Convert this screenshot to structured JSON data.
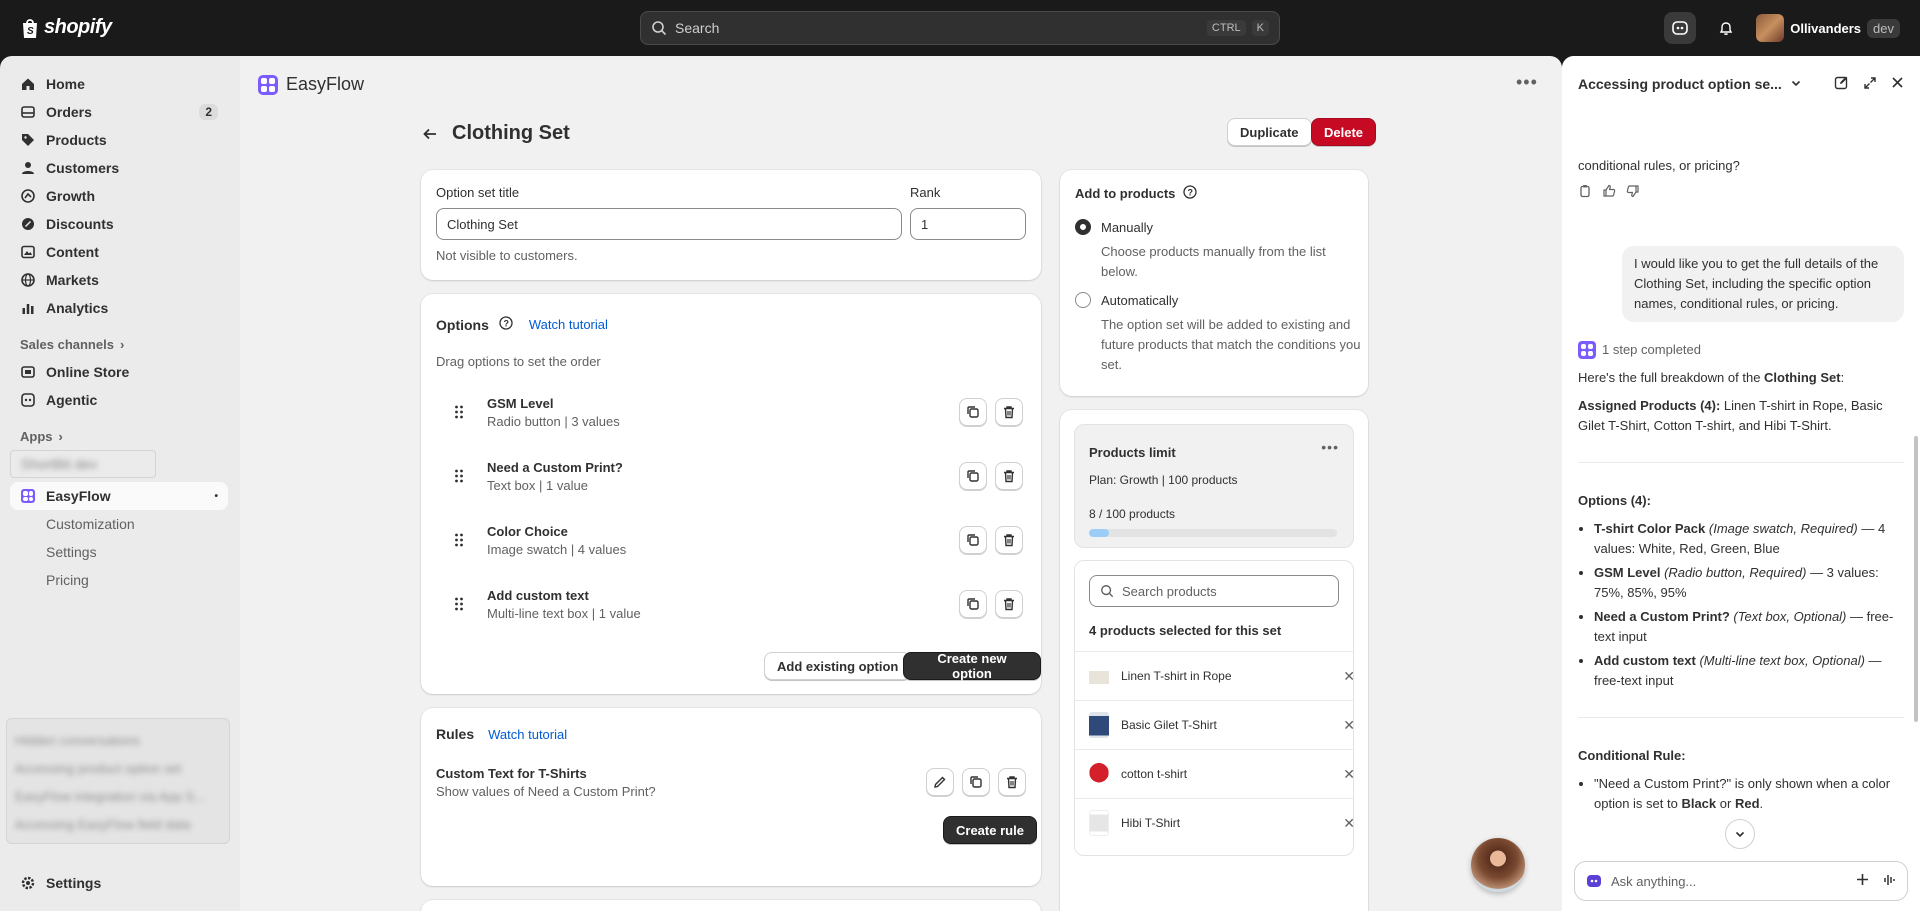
{
  "topbar": {
    "brand": "shopify",
    "search_placeholder": "Search",
    "key_ctrl": "CTRL",
    "key_k": "K",
    "store_name": "Ollivanders",
    "store_tag": "dev"
  },
  "sidebar": {
    "items": [
      {
        "label": "Home",
        "icon": "home-icon"
      },
      {
        "label": "Orders",
        "icon": "orders-icon",
        "badge": "2"
      },
      {
        "label": "Products",
        "icon": "tag-icon"
      },
      {
        "label": "Customers",
        "icon": "person-icon"
      },
      {
        "label": "Growth",
        "icon": "growth-icon"
      },
      {
        "label": "Discounts",
        "icon": "discount-icon"
      },
      {
        "label": "Content",
        "icon": "content-icon"
      },
      {
        "label": "Markets",
        "icon": "globe-icon"
      },
      {
        "label": "Analytics",
        "icon": "chart-icon"
      }
    ],
    "sales_channels_label": "Sales channels",
    "channels": [
      "Online Store",
      "Agentic"
    ],
    "apps_label": "Apps",
    "blurred_app": "ShortBit dev",
    "easyflow_label": "EasyFlow",
    "easyflow_sub": [
      "Customization",
      "Settings",
      "Pricing"
    ],
    "blurred_conversations": [
      "Hidden conversations",
      "Accessing product option set",
      "EasyFlow integration via App S...",
      "Accessing EasyFlow field data"
    ],
    "settings_label": "Settings"
  },
  "app": {
    "name": "EasyFlow",
    "page_title": "Clothing Set",
    "duplicate_label": "Duplicate",
    "delete_label": "Delete"
  },
  "option_set": {
    "title_label": "Option set title",
    "title_value": "Clothing Set",
    "rank_label": "Rank",
    "rank_value": "1",
    "help": "Not visible to customers."
  },
  "options": {
    "heading": "Options",
    "tutorial": "Watch tutorial",
    "hint": "Drag options to set the order",
    "items": [
      {
        "title": "GSM Level",
        "sub": "Radio button | 3 values"
      },
      {
        "title": "Need a Custom Print?",
        "sub": "Text box | 1 value"
      },
      {
        "title": "Color Choice",
        "sub": "Image swatch | 4 values"
      },
      {
        "title": "Add custom text",
        "sub": "Multi-line text box | 1 value"
      }
    ],
    "add_existing": "Add existing option",
    "create_new": "Create new option"
  },
  "rules": {
    "heading": "Rules",
    "tutorial": "Watch tutorial",
    "rule_title": "Custom Text for T-Shirts",
    "rule_sub": "Show values of Need a Custom Print?",
    "create_rule": "Create rule"
  },
  "add_to_products": {
    "heading": "Add to products",
    "manual_label": "Manually",
    "manual_desc": "Choose products manually from the list below.",
    "auto_label": "Automatically",
    "auto_desc": "The option set will be added to existing and future products that match the conditions you set.",
    "selected": "manual"
  },
  "products_limit": {
    "heading": "Products limit",
    "plan": "Plan: Growth | 100 products",
    "usage": "8 / 100 products",
    "fraction": 0.08
  },
  "product_list": {
    "search_placeholder": "Search products",
    "count_label": "4 products selected for this set",
    "items": [
      {
        "name": "Linen T-shirt in Rope",
        "color": "#e8e4da"
      },
      {
        "name": "Basic Gilet T-Shirt",
        "color": "#2f4a7a"
      },
      {
        "name": "cotton t-shirt",
        "color": "#d3202a"
      },
      {
        "name": "Hibi T-Shirt",
        "color": "#eeeeee"
      }
    ]
  },
  "chat": {
    "title": "Accessing product option se...",
    "prev_tail": "conditional rules, or pricing?",
    "user_message": "I would like you to get the full details of the Clothing Set, including the specific option names, conditional rules, or pricing.",
    "step": "1 step completed",
    "intro_pre": "Here's the full breakdown of the ",
    "intro_bold": "Clothing Set",
    "intro_post": ":",
    "assigned_label": "Assigned Products (4):",
    "assigned_text": " Linen T-shirt in Rope, Basic Gilet T-Shirt, Cotton T-shirt, and Hibi T-Shirt.",
    "options_label": "Options (4):",
    "option_lines": [
      {
        "name": "T-shirt Color Pack",
        "type": "(Image swatch, Required)",
        "rest": " — 4 values: White, Red, Green, Blue"
      },
      {
        "name": "GSM Level",
        "type": "(Radio button, Required)",
        "rest": " — 3 values: 75%, 85%, 95%"
      },
      {
        "name": "Need a Custom Print?",
        "type": "(Text box, Optional)",
        "rest": " — free-text input"
      },
      {
        "name": "Add custom text",
        "type": "(Multi-line text box, Optional)",
        "rest": " — free-text input"
      }
    ],
    "rule_label": "Conditional Rule:",
    "rule_pre": "\"Need a Custom Print?\" is only shown when a color option is set to ",
    "rule_b1": "Black",
    "rule_mid": " or ",
    "rule_b2": "Red",
    "rule_end": ".",
    "input_placeholder": "Ask anything..."
  }
}
